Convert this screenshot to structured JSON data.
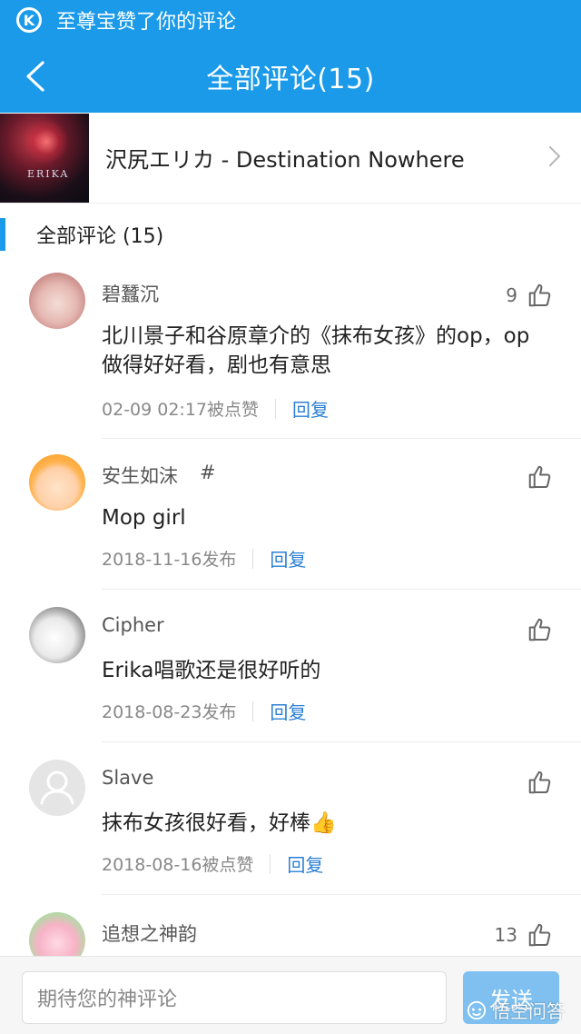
{
  "notification": {
    "text": "至尊宝赞了你的评论",
    "icon": "k-circle-icon"
  },
  "header": {
    "title": "全部评论(15)",
    "back_icon": "chevron-left-icon"
  },
  "song": {
    "title": "沢尻エリカ - Destination Nowhere",
    "chevron_icon": "chevron-right-icon"
  },
  "section": {
    "label": "全部评论 (15)"
  },
  "comments": [
    {
      "user": "碧蠶沉",
      "likes": "9",
      "text_line1": "北川景子和谷原章介的《抹布女孩》的op，op",
      "text_line2": "做得好好看，剧也有意思",
      "meta": "02-09 02:17被点赞",
      "reply": "回复"
    },
    {
      "user": "安生如沫",
      "tag": "#",
      "likes": "",
      "text_line1": "Mop girl",
      "text_line2": "",
      "meta": "2018-11-16发布",
      "reply": "回复"
    },
    {
      "user": "Cipher",
      "likes": "",
      "text_line1": "Erika唱歌还是很好听的",
      "text_line2": "",
      "meta": "2018-08-23发布",
      "reply": "回复"
    },
    {
      "user": "Slave",
      "likes": "",
      "text_line1": "抹布女孩很好看，好棒👍",
      "text_line2": "",
      "meta": "2018-08-16被点赞",
      "reply": "回复"
    },
    {
      "user": "追想之神韵",
      "likes": "13",
      "text_line1": "",
      "text_line2": "",
      "meta": "",
      "reply": ""
    }
  ],
  "bottom": {
    "placeholder": "期待您的神评论",
    "send": "发送"
  },
  "watermark": {
    "text": "悟空问答",
    "icon": "wukong-icon"
  }
}
